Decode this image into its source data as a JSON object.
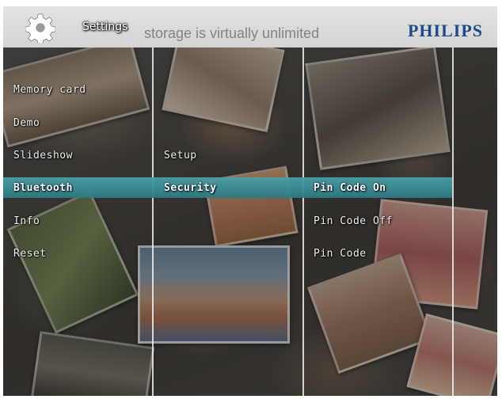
{
  "header": {
    "title": "Settings",
    "background_text": "storage is virtually unlimited",
    "brand": "PHILIPS",
    "icon": "gear-icon"
  },
  "columns": [
    {
      "items": [
        {
          "label": "Memory card",
          "selected": false
        },
        {
          "label": "Demo",
          "selected": false
        },
        {
          "label": "Slideshow",
          "selected": false
        },
        {
          "label": "Bluetooth",
          "selected": true
        },
        {
          "label": "Info",
          "selected": false
        },
        {
          "label": "Reset",
          "selected": false
        }
      ]
    },
    {
      "items": [
        {
          "label": "Setup",
          "selected": false
        },
        {
          "label": "Security",
          "selected": true
        }
      ]
    },
    {
      "items": [
        {
          "label": "Pin Code On",
          "selected": true
        },
        {
          "label": "Pin Code Off",
          "selected": false
        },
        {
          "label": "Pin Code",
          "selected": false
        }
      ]
    }
  ],
  "colors": {
    "highlight": "#3a8e96",
    "brand": "#1e4a8c",
    "header_bg": "#d8d8d6"
  }
}
